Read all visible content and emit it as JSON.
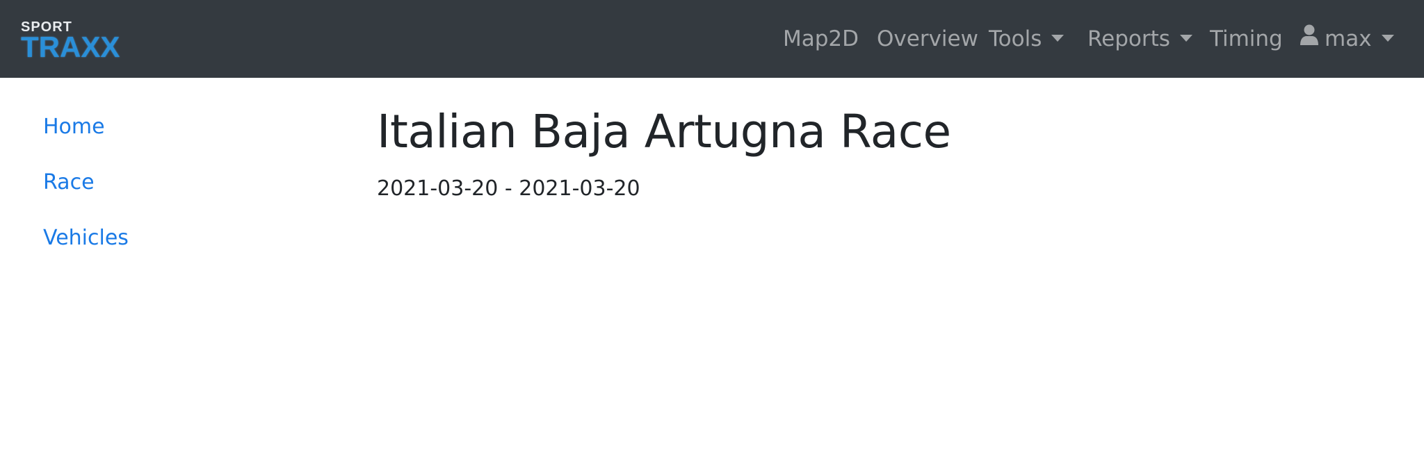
{
  "navbar": {
    "brand": {
      "top": "SPORT",
      "bottom": "TRAXX"
    },
    "items": [
      {
        "label": "Map2D"
      },
      {
        "label": "Overview"
      },
      {
        "label": "Tools"
      },
      {
        "label": "Reports"
      },
      {
        "label": "Timing"
      },
      {
        "label": "max",
        "icon": "user-icon"
      }
    ]
  },
  "sidebar": {
    "items": [
      {
        "label": "Home"
      },
      {
        "label": "Race"
      },
      {
        "label": "Vehicles"
      }
    ]
  },
  "main": {
    "title": "Italian Baja Artugna Race",
    "dates": "2021-03-20 - 2021-03-20"
  },
  "colors": {
    "navbar_bg": "#343a40",
    "nav_text": "#9a9da0",
    "link": "#1a7ae6",
    "brand_blue": "#2a8fd8"
  }
}
